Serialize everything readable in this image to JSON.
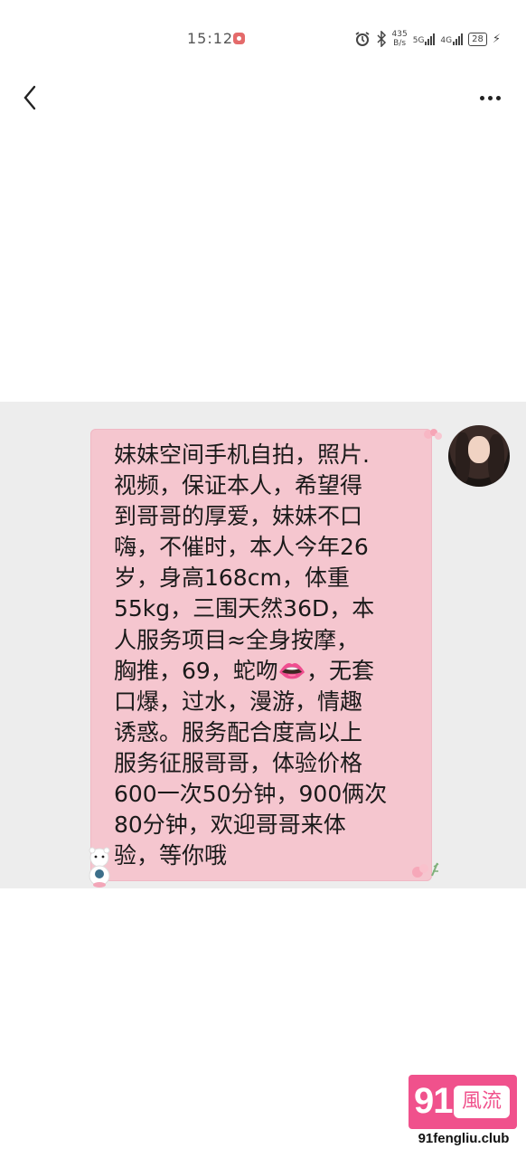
{
  "status_bar": {
    "time": "15:12",
    "net_speed_value": "435",
    "net_speed_unit": "B/s",
    "signal_1_label": "5G",
    "signal_2_label": "4G",
    "battery": "28",
    "icons": [
      "recording-icon",
      "alarm-icon",
      "bluetooth-icon",
      "signal-icon",
      "battery-icon",
      "charging-icon"
    ]
  },
  "nav": {
    "back_icon": "chevron-left-icon",
    "more_icon": "more-dots-icon"
  },
  "message": {
    "text": "妹妹空间手机自拍，照片.\n视频，保证本人，希望得\n到哥哥的厚爱，妹妹不口\n嗨，不催时，本人今年26\n岁，身高168cm，体重\n55kg，三围天然36D，本\n人服务项目≈全身按摩，\n胸推，69，蛇吻👄，无套\n口爆，过水，漫游，情趣\n诱惑。服务配合度高以上\n服务征服哥哥，体验价格\n600一次50分钟，900俩次\n80分钟，欢迎哥哥来体\n验，等你哦",
    "bubble_color": "#f5c6cf"
  },
  "watermark": {
    "number": "91",
    "word": "風流",
    "domain": "91fengliu.club",
    "color": "#f0518c"
  }
}
